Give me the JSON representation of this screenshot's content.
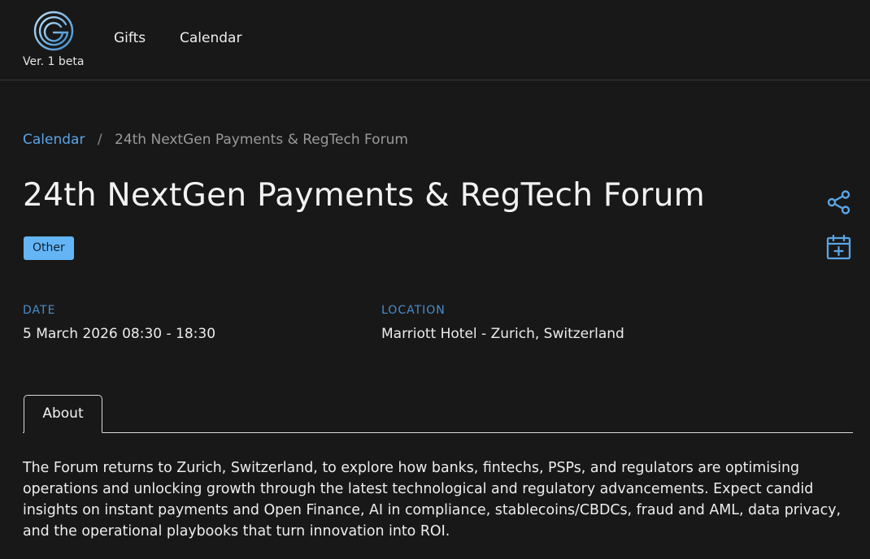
{
  "header": {
    "logo_icon": "g-logo-icon",
    "version": "Ver. 1 beta",
    "nav": {
      "gifts": "Gifts",
      "calendar": "Calendar"
    }
  },
  "breadcrumb": {
    "parent": "Calendar",
    "separator": "/",
    "current": "24th NextGen Payments & RegTech Forum"
  },
  "event": {
    "title": "24th NextGen Payments & RegTech Forum",
    "category_badge": "Other",
    "actions": {
      "share_icon": "share-icon",
      "add_to_calendar_icon": "calendar-plus-icon"
    },
    "date_label": "DATE",
    "date_value": "5 March 2026 08:30 - 18:30",
    "location_label": "LOCATION",
    "location_value": "Marriott Hotel - Zurich, Switzerland"
  },
  "tabs": [
    {
      "label": "About",
      "active": true
    }
  ],
  "about": {
    "text": "The Forum returns to Zurich, Switzerland, to explore how banks, fintechs, PSPs, and regulators are optimising operations and unlocking growth through the latest technological and regulatory advancements. Expect candid insights on instant payments and Open Finance, AI in compliance, stablecoins/CBDCs, fraud and AML, data privacy, and the operational playbooks that turn innovation into ROI."
  },
  "colors": {
    "background": "#181818",
    "accent": "#5aa5e6",
    "badge": "#64b5f6",
    "meta_label": "#4a8dc9",
    "divider": "#3a3a3a"
  }
}
